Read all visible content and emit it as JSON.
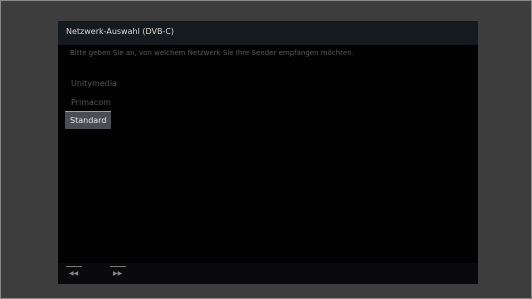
{
  "window": {
    "title": "Netzwerk-Auswahl (DVB-C)"
  },
  "prompt": "Bitte geben Sie an, von welchem Netzwerk Sie Ihre Sender empfangen möchten.",
  "options": [
    {
      "label": "Unitymedia",
      "selected": false
    },
    {
      "label": "Primacom",
      "selected": false
    },
    {
      "label": "Standard",
      "selected": true
    }
  ],
  "bottom_bar": {
    "rewind_icon": "rewind-icon",
    "forward_icon": "fast-forward-icon"
  },
  "colors": {
    "background": "#020202",
    "title_bar": "#151a1f",
    "selected_bg": "#4a4e52",
    "frame": "#3d3d3d"
  }
}
